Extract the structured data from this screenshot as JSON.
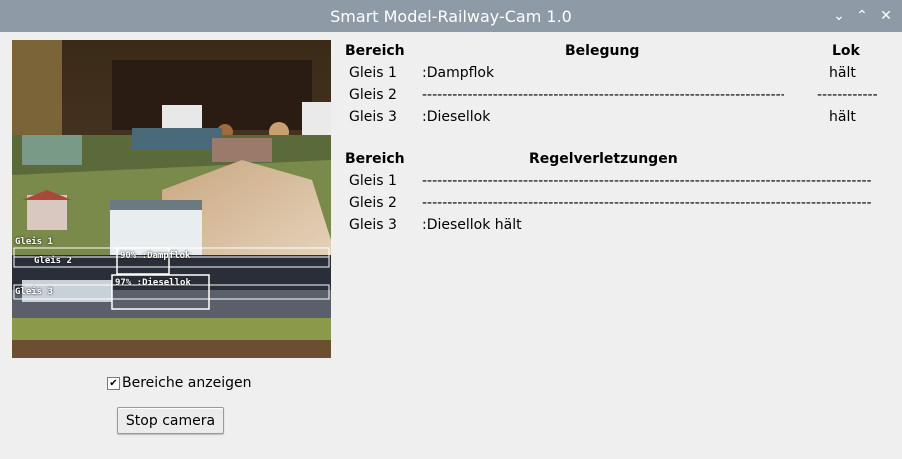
{
  "window": {
    "title": "Smart Model-Railway-Cam 1.0"
  },
  "camera": {
    "labels": [
      "Gleis 1",
      "Gleis 2",
      "Gleis 3",
      "90% :Dampflok",
      "97% :Diesellok"
    ]
  },
  "controls": {
    "show_regions_label": "Bereiche anzeigen",
    "show_regions_checked": true,
    "stop_button": "Stop camera"
  },
  "occupancy": {
    "headers": {
      "area": "Bereich",
      "occupancy": "Belegung",
      "loco": "Lok"
    },
    "rows": [
      {
        "area": "Gleis 1",
        "occupancy": ":Dampflok",
        "loco": "hält"
      },
      {
        "area": "Gleis 2",
        "occupancy": "-------------------------------------------------------------------------------",
        "loco": "-------------"
      },
      {
        "area": "Gleis 3",
        "occupancy": ":Diesellok",
        "loco": "hält"
      }
    ]
  },
  "violations": {
    "headers": {
      "area": "Bereich",
      "rules": "Regelverletzungen"
    },
    "rows": [
      {
        "area": "Gleis 1",
        "value": "-------------------------------------------------------------------------------------------"
      },
      {
        "area": "Gleis 2",
        "value": "-------------------------------------------------------------------------------------------"
      },
      {
        "area": "Gleis 3",
        "value": ":Diesellok hält"
      }
    ]
  }
}
